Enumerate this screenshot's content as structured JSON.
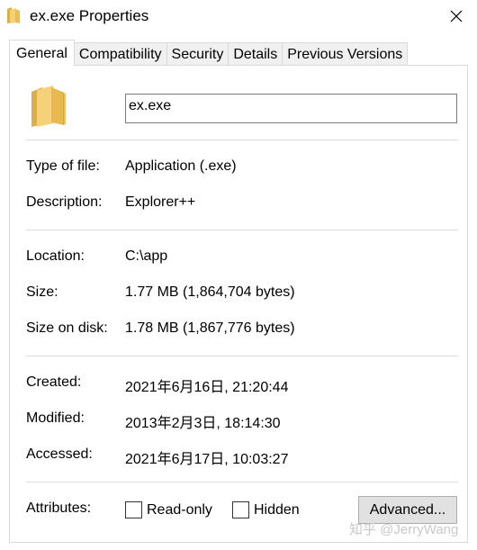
{
  "window": {
    "title": "ex.exe Properties",
    "close_icon": "close-icon",
    "folder_icon": "folder-icon"
  },
  "tabs": [
    {
      "label": "General",
      "active": true
    },
    {
      "label": "Compatibility",
      "active": false
    },
    {
      "label": "Security",
      "active": false
    },
    {
      "label": "Details",
      "active": false
    },
    {
      "label": "Previous Versions",
      "active": false
    }
  ],
  "general": {
    "file_name": "ex.exe",
    "type_label": "Type of file:",
    "type_value": "Application (.exe)",
    "description_label": "Description:",
    "description_value": "Explorer++",
    "location_label": "Location:",
    "location_value": "C:\\app",
    "size_label": "Size:",
    "size_value": "1.77 MB (1,864,704 bytes)",
    "size_on_disk_label": "Size on disk:",
    "size_on_disk_value": "1.78 MB (1,867,776 bytes)",
    "created_label": "Created:",
    "created_value": "2021年6月16日, 21:20:44",
    "modified_label": "Modified:",
    "modified_value": "2013年2月3日, 18:14:30",
    "accessed_label": "Accessed:",
    "accessed_value": "2021年6月17日, 10:03:27",
    "attributes_label": "Attributes:",
    "readonly_label": "Read-only",
    "readonly_checked": false,
    "hidden_label": "Hidden",
    "hidden_checked": false,
    "advanced_button": "Advanced..."
  },
  "watermark": "知乎 @JerryWang",
  "colors": {
    "folder_light": "#f5d27a",
    "folder_dark": "#dcae45",
    "separator": "#dcdcdc",
    "button_bg": "#e1e1e1"
  }
}
